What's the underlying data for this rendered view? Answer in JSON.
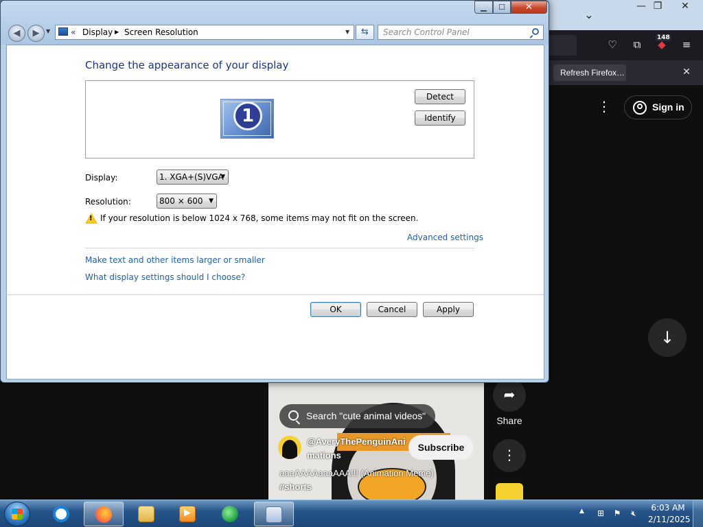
{
  "browser": {
    "badge_count": "148",
    "notification_button": "Refresh Firefox…",
    "icons": [
      "pocket-icon",
      "extensions-icon",
      "ublock-icon",
      "hamburger-menu-icon"
    ]
  },
  "youtube": {
    "sign_in": "Sign in",
    "search_suggestion": "Search \"cute animal videos\"",
    "channel_name": "@AveryThePenguinAnimations",
    "subscribe": "Subscribe",
    "video_title": "aaaAAAAaaaAAA!!!  (Animation Meme)",
    "video_hashtag": "#shorts",
    "share_label": "Share"
  },
  "window": {
    "address": {
      "crumbs": [
        "Display",
        "Screen Resolution"
      ]
    },
    "search_placeholder": "Search Control Panel",
    "title": "Change the appearance of your display",
    "monitor_number": "1",
    "buttons": {
      "detect": "Detect",
      "identify": "Identify",
      "ok": "OK",
      "cancel": "Cancel",
      "apply": "Apply"
    },
    "display_label": "Display:",
    "display_value": "1. XGA+(S)VGA",
    "resolution_label": "Resolution:",
    "resolution_value": "800 × 600",
    "warning": "If your resolution is below 1024 x 768, some items may not fit on the screen.",
    "advanced_link": "Advanced settings",
    "links": {
      "text_size": "Make text and other items larger or smaller",
      "help": "What display settings should I choose?"
    }
  },
  "taskbar": {
    "apps": [
      "internet-explorer",
      "firefox",
      "windows-explorer",
      "windows-media-player",
      "windows-media-center",
      "control-panel"
    ],
    "clock_time": "6:03 AM",
    "clock_date": "2/11/2025"
  }
}
